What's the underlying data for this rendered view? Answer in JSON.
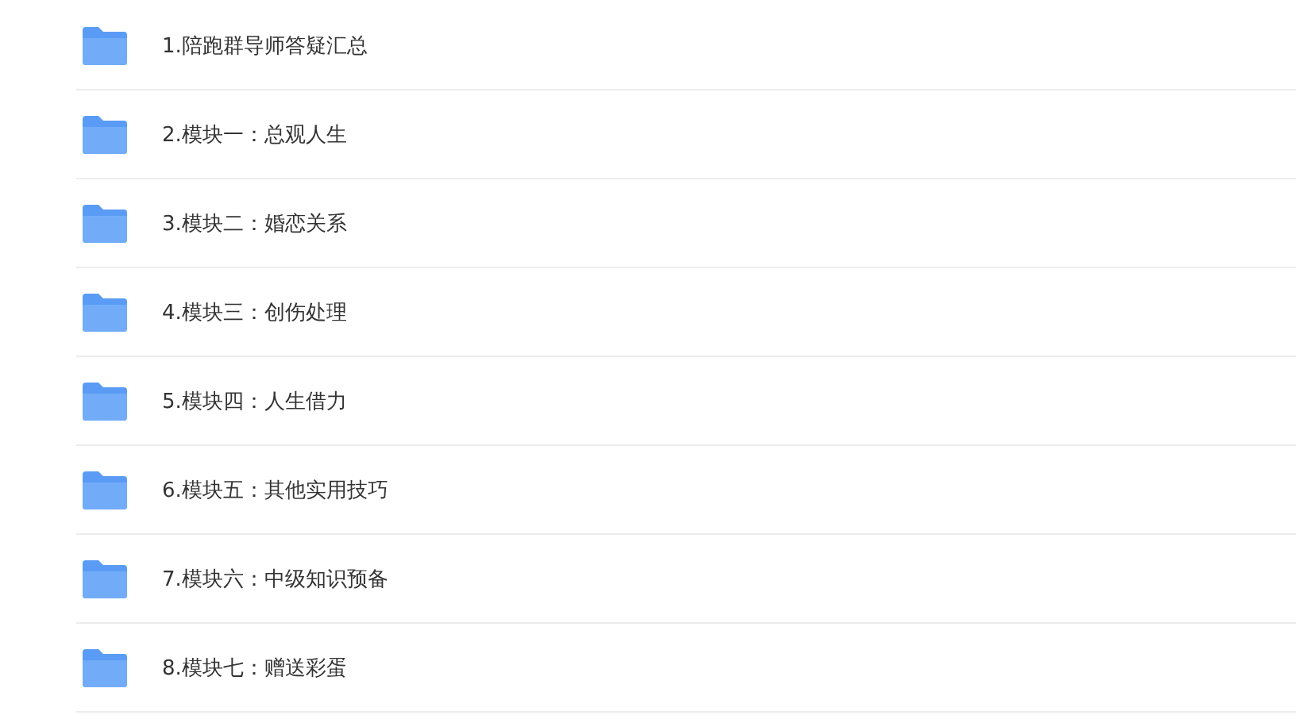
{
  "files": [
    {
      "name": "1.陪跑群导师答疑汇总",
      "kind": "folder"
    },
    {
      "name": "2.模块一：总观人生",
      "kind": "folder"
    },
    {
      "name": "3.模块二：婚恋关系",
      "kind": "folder"
    },
    {
      "name": "4.模块三：创伤处理",
      "kind": "folder"
    },
    {
      "name": "5.模块四：人生借力",
      "kind": "folder"
    },
    {
      "name": "6.模块五：其他实用技巧",
      "kind": "folder"
    },
    {
      "name": "7.模块六：中级知识预备",
      "kind": "folder"
    },
    {
      "name": "8.模块七：赠送彩蛋",
      "kind": "folder"
    }
  ]
}
